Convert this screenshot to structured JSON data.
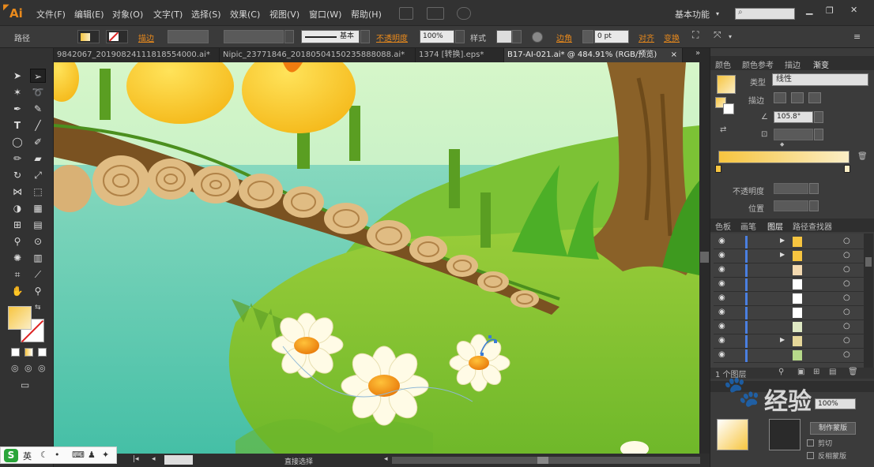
{
  "menubar": {
    "logo": "Ai",
    "items": [
      "文件(F)",
      "编辑(E)",
      "对象(O)",
      "文字(T)",
      "选择(S)",
      "效果(C)",
      "视图(V)",
      "窗口(W)",
      "帮助(H)"
    ],
    "workspace": "基本功能"
  },
  "control": {
    "object_type": "路径",
    "stroke_label": "描边",
    "stroke_style": "基本",
    "opacity_label": "不透明度",
    "opacity_value": "100%",
    "style_label": "样式",
    "corner_label": "边角",
    "corner_value": "0 pt",
    "align_label": "对齐",
    "transform_label": "变换"
  },
  "tabs": [
    "9842067_20190824111818554000.ai*",
    "Nipic_23771846_20180504150235888088.ai*",
    "1374 [转换].eps*",
    "B17-AI-021.ai* @ 484.91% (RGB/预览)"
  ],
  "gradient_panel": {
    "tabs": [
      "颜色",
      "颜色参考",
      "描边",
      "渐变"
    ],
    "type_label": "类型",
    "type_value": "线性",
    "stroke_label": "描边",
    "angle_value": "105.8°",
    "opacity_label": "不透明度",
    "position_label": "位置",
    "start_color": "#f7c540",
    "end_color": "#fbeec6"
  },
  "layers_panel": {
    "tabs": [
      "色板",
      "画笔",
      "图层",
      "路径查找器"
    ],
    "row_count": 9,
    "footer": "1 个图层"
  },
  "bottom_panel": {
    "opacity_value": "100%",
    "make_mask": "制作蒙版",
    "clip": "剪切",
    "invert_mask": "反相蒙版"
  },
  "status_bar": {
    "zoom": "",
    "tool": "直接选择"
  },
  "watermark": "经验",
  "ime": {
    "label": "英"
  },
  "colors": {
    "accent": "#e98a1c",
    "fill": "#f7c540"
  }
}
